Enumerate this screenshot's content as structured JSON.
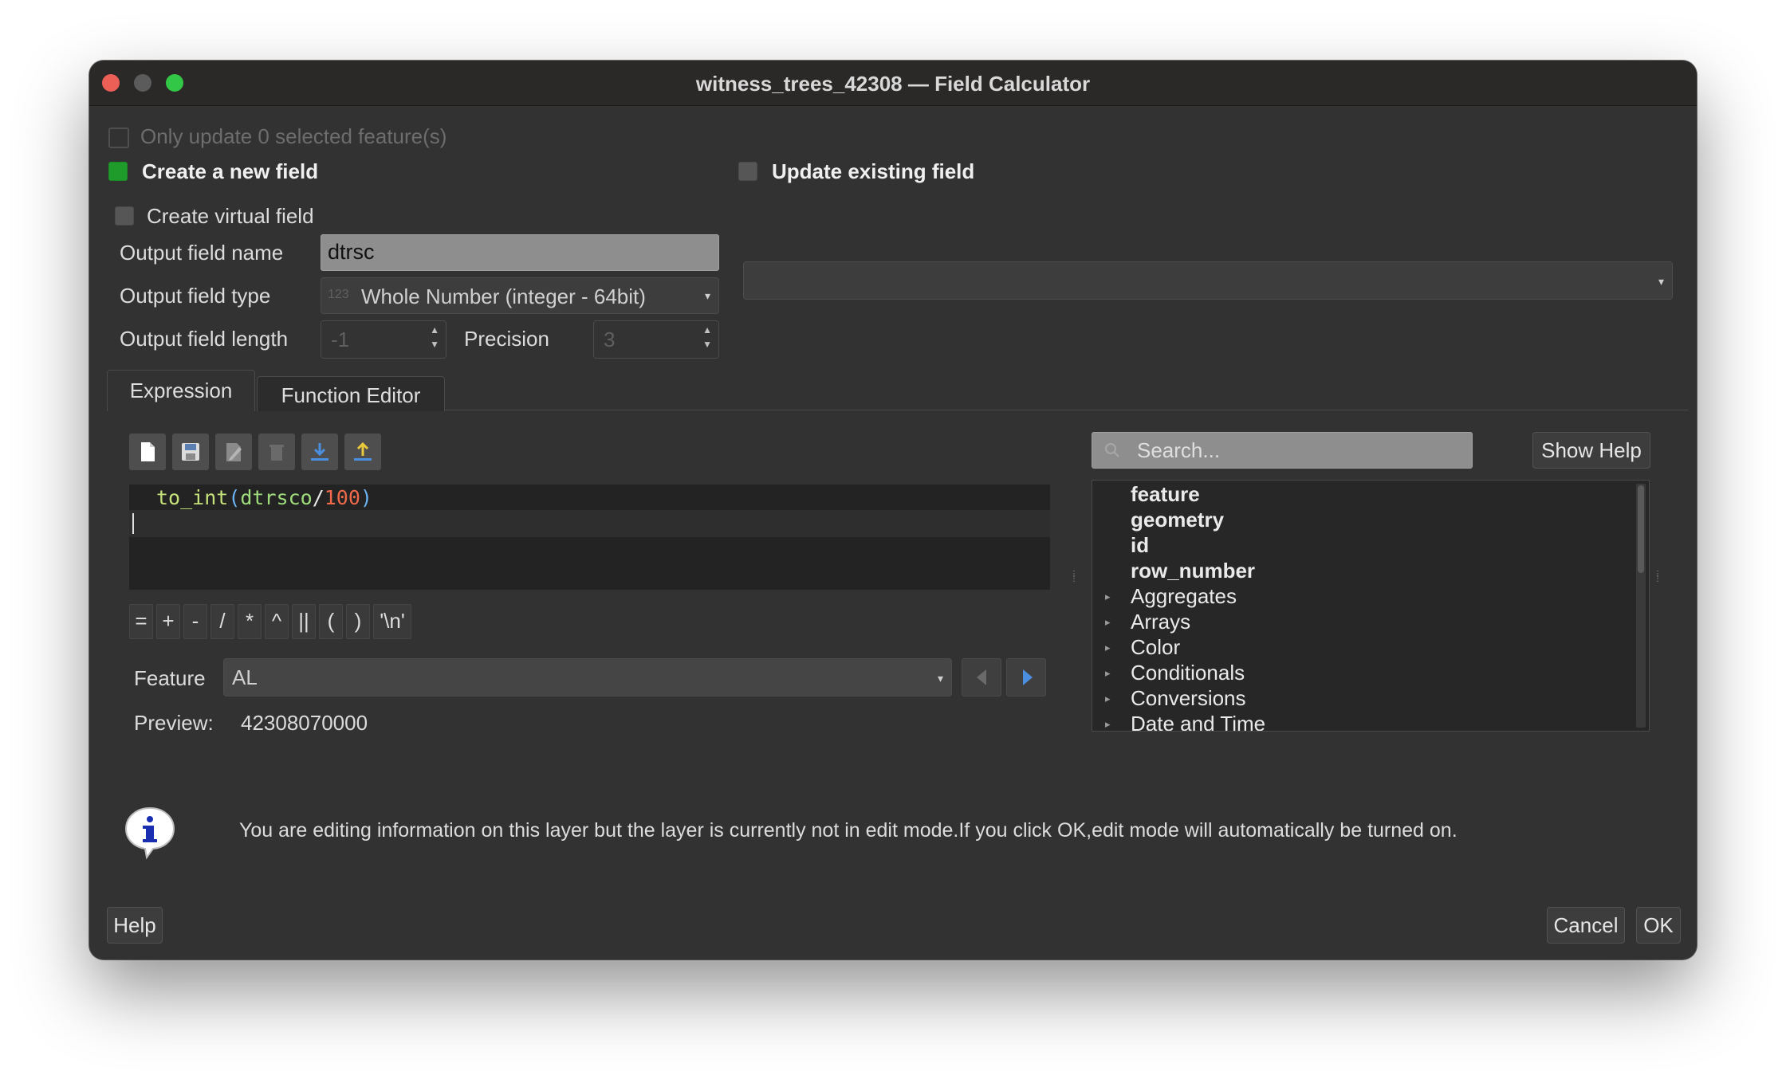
{
  "window": {
    "title": "witness_trees_42308 — Field Calculator"
  },
  "options": {
    "only_update_label": "Only update 0 selected feature(s)",
    "create_new_field_label": "Create a new field",
    "update_existing_label": "Update existing field",
    "create_virtual_label": "Create virtual field"
  },
  "output": {
    "name_label": "Output field name",
    "name_value": "dtrsc",
    "type_label": "Output field type",
    "type_icon": "123",
    "type_value": "Whole Number (integer - 64bit)",
    "length_label": "Output field length",
    "length_value": "-1",
    "precision_label": "Precision",
    "precision_value": "3"
  },
  "tabs": {
    "expression": "Expression",
    "function_editor": "Function Editor"
  },
  "toolbar": {
    "icons": [
      "new-file-icon",
      "save-icon",
      "edit-icon",
      "delete-icon",
      "import-icon",
      "export-icon"
    ]
  },
  "editor": {
    "func": "to_int",
    "open_paren": "(",
    "field": "dtrsco",
    "op": "/",
    "number": "100",
    "close_paren": ")"
  },
  "operators": [
    "=",
    "+",
    "-",
    "/",
    "*",
    "^",
    "||",
    "(",
    ")",
    "'\\n'"
  ],
  "feature": {
    "label": "Feature",
    "value": "AL"
  },
  "preview": {
    "label": "Preview:",
    "value": "42308070000"
  },
  "search": {
    "placeholder": "Search..."
  },
  "show_help_label": "Show Help",
  "tree": {
    "items": [
      {
        "label": "feature",
        "bold": true,
        "expandable": false
      },
      {
        "label": "geometry",
        "bold": true,
        "expandable": false
      },
      {
        "label": "id",
        "bold": true,
        "expandable": false
      },
      {
        "label": "row_number",
        "bold": true,
        "expandable": false
      },
      {
        "label": "Aggregates",
        "bold": false,
        "expandable": true
      },
      {
        "label": "Arrays",
        "bold": false,
        "expandable": true
      },
      {
        "label": "Color",
        "bold": false,
        "expandable": true
      },
      {
        "label": "Conditionals",
        "bold": false,
        "expandable": true
      },
      {
        "label": "Conversions",
        "bold": false,
        "expandable": true
      },
      {
        "label": "Date and Time",
        "bold": false,
        "expandable": true
      }
    ]
  },
  "info": {
    "message": "You are editing information on this layer but the layer is currently not in edit mode.If you click OK,edit mode will automatically be turned on."
  },
  "buttons": {
    "help": "Help",
    "cancel": "Cancel",
    "ok": "OK"
  },
  "colors": {
    "window_bg": "#323232",
    "checkbox_green": "#1f9b2b",
    "code_function": "#c6e27a",
    "code_field": "#9fdc7b",
    "code_operator": "#e8e8e8",
    "code_number": "#f06a4a",
    "code_paren": "#6cb3f5"
  }
}
